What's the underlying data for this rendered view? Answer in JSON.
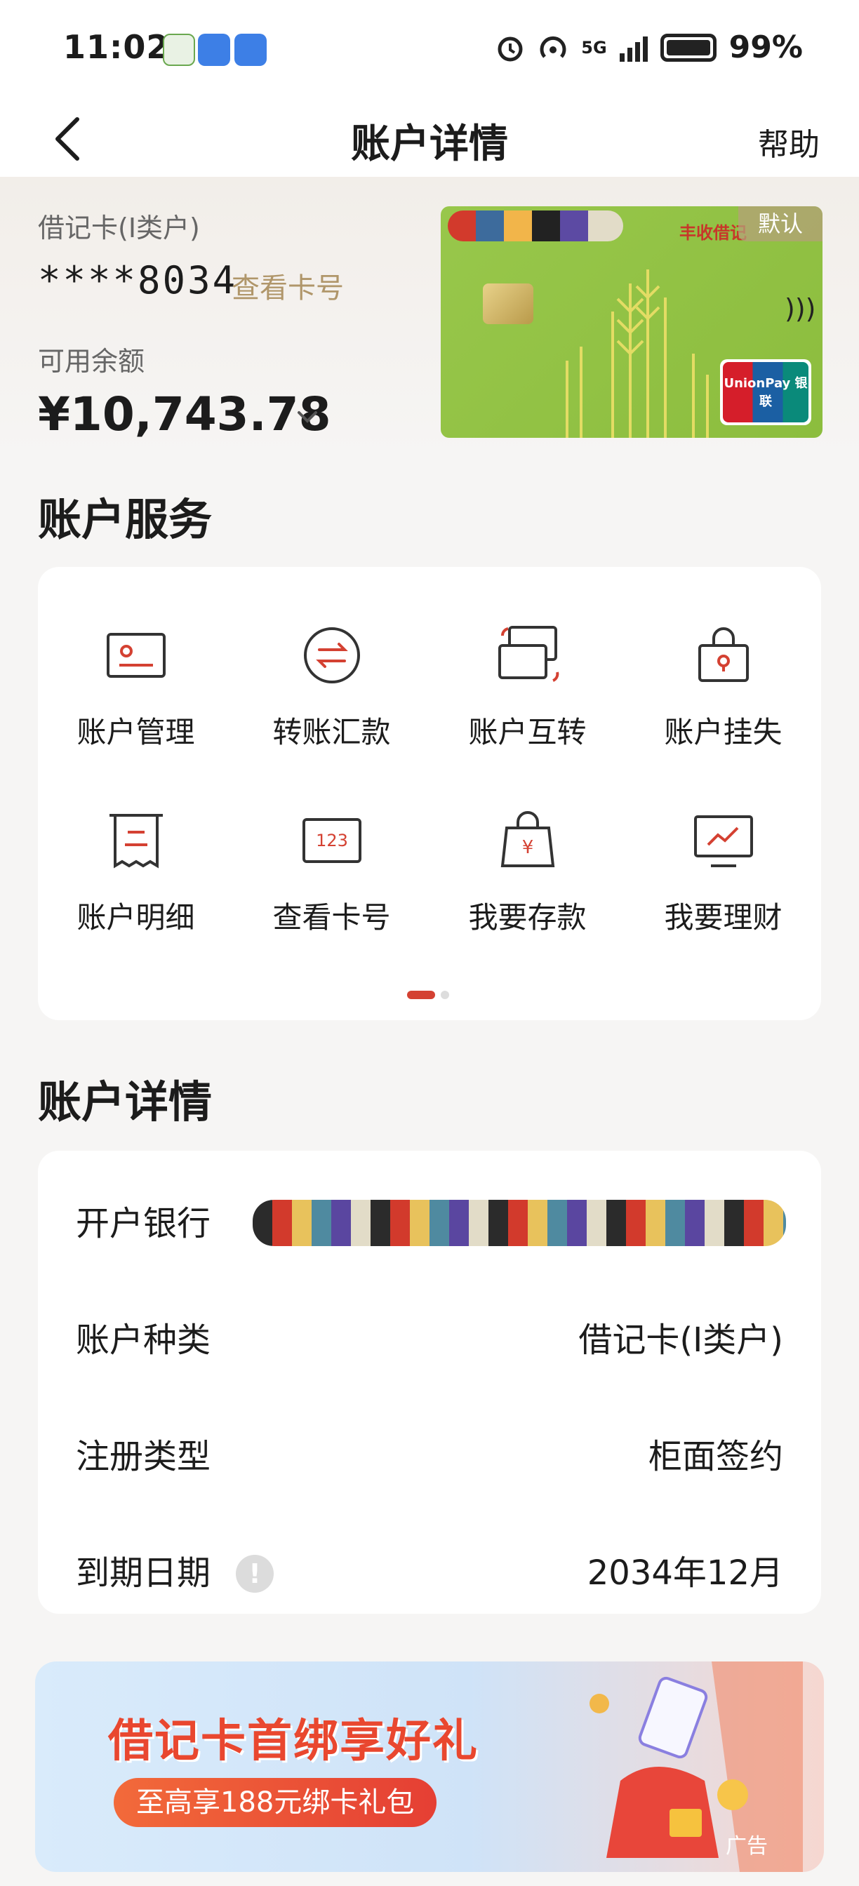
{
  "status_bar": {
    "time": "11:02",
    "battery": "99%",
    "network": "5G"
  },
  "nav": {
    "title": "账户详情",
    "help": "帮助"
  },
  "account": {
    "type": "借记卡(I类户)",
    "number": "****8034",
    "view_card_link": "查看卡号",
    "balance_label": "可用余额",
    "balance": "¥10,743.78"
  },
  "card": {
    "bank_name": "丰收借记",
    "default_tag": "默认",
    "unionpay_text": "UnionPay 银联"
  },
  "services": {
    "title": "账户服务",
    "items": [
      {
        "label": "账户管理",
        "icon": "id-card-icon"
      },
      {
        "label": "转账汇款",
        "icon": "transfer-icon"
      },
      {
        "label": "账户互转",
        "icon": "cards-swap-icon"
      },
      {
        "label": "账户挂失",
        "icon": "lock-bag-icon"
      },
      {
        "label": "账户明细",
        "icon": "receipt-icon"
      },
      {
        "label": "查看卡号",
        "icon": "card-number-icon"
      },
      {
        "label": "我要存款",
        "icon": "deposit-bag-icon"
      },
      {
        "label": "我要理财",
        "icon": "chart-monitor-icon"
      }
    ],
    "page_indicator": {
      "current": 1,
      "total": 2
    }
  },
  "details": {
    "title": "账户详情",
    "rows": [
      {
        "label": "开户银行",
        "value": ""
      },
      {
        "label": "账户种类",
        "value": "借记卡(I类户)"
      },
      {
        "label": "注册类型",
        "value": "柜面签约"
      },
      {
        "label": "到期日期",
        "value": "2034年12月"
      }
    ]
  },
  "banner": {
    "title": "借记卡首绑享好礼",
    "subtitle": "至高享188元绑卡礼包",
    "ad_tag": "广告"
  },
  "colors": {
    "accent_red": "#d44132",
    "gold_link": "#b0966a",
    "card_green": "#98c74b"
  }
}
